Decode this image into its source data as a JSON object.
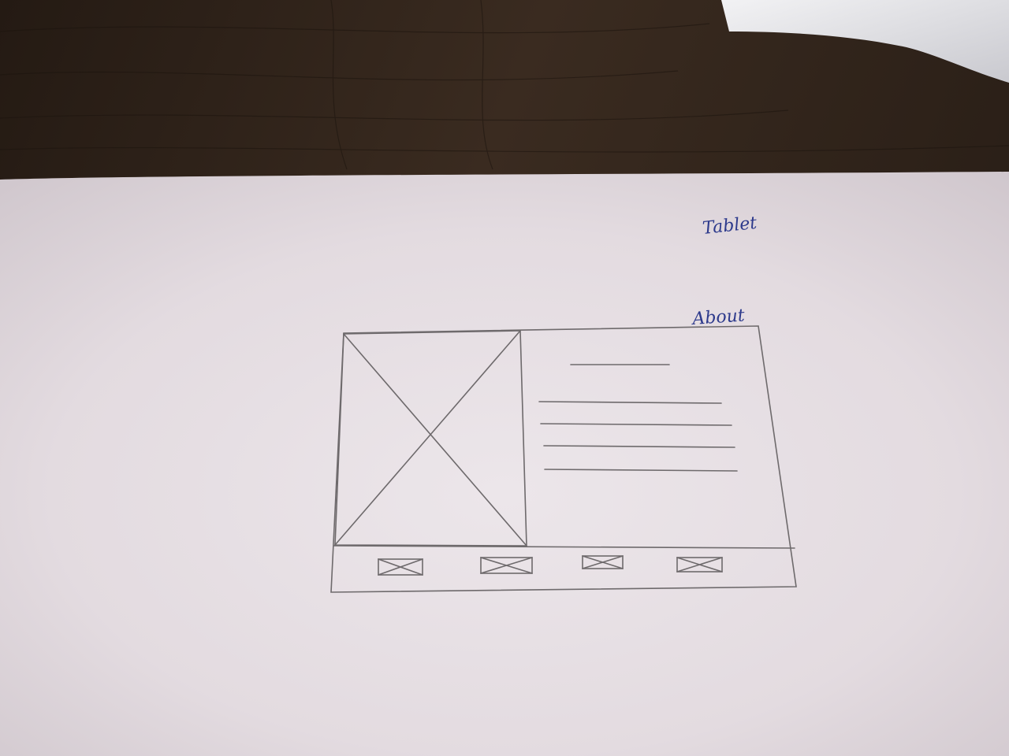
{
  "labels": {
    "device": "Tablet",
    "page": "About"
  },
  "colors": {
    "table": "#2e2219",
    "paper": "#e9e2e6",
    "pencil": "#6e6a6c",
    "ink": "#2d3a8c"
  }
}
